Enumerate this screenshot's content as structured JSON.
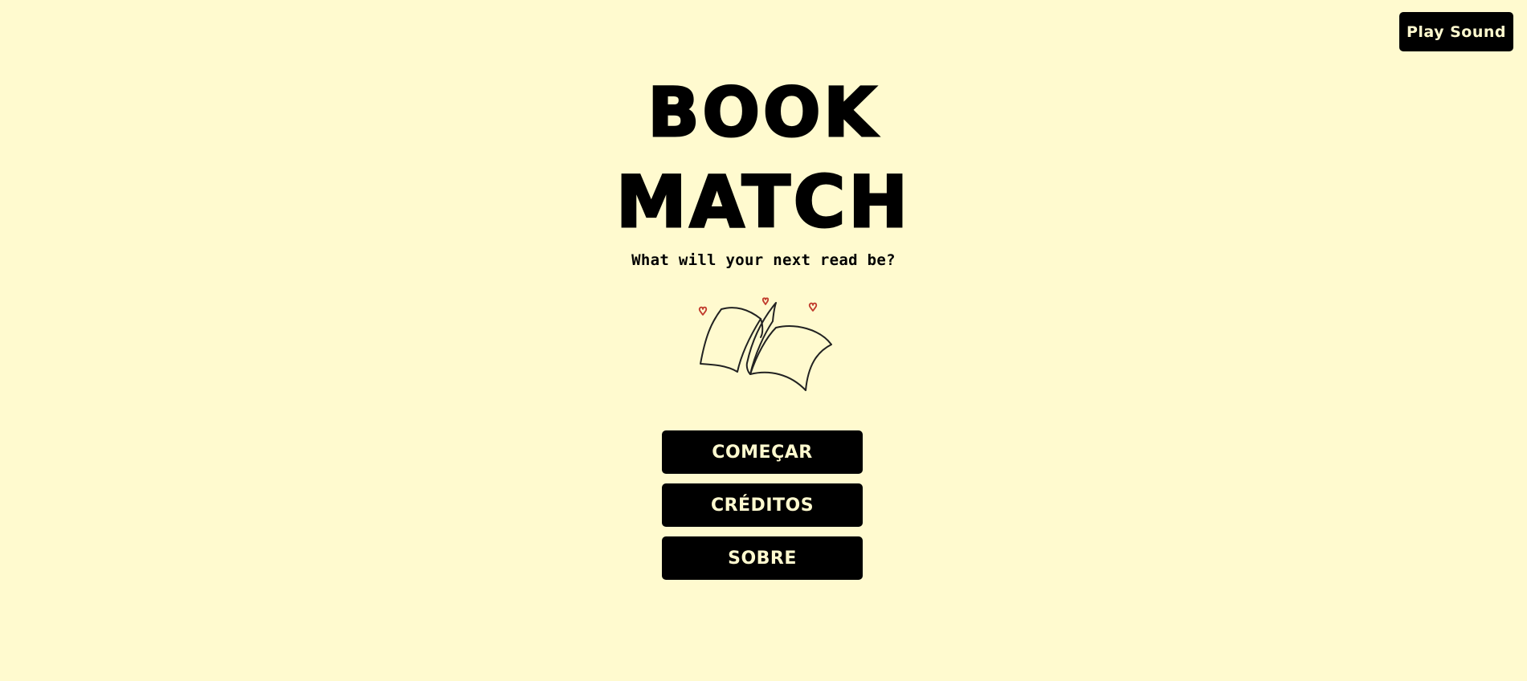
{
  "header": {
    "sound_button_label": "Play Sound"
  },
  "hero": {
    "title_line1": "BOOK",
    "title_line2": "MATCH",
    "tagline": "What will your next read be?",
    "illustration_icon": "open-book-with-hearts-icon"
  },
  "menu": {
    "start_label": "COMEÇAR",
    "credits_label": "CRÉDITOS",
    "about_label": "SOBRE"
  },
  "colors": {
    "background": "#fffacf",
    "button_bg": "#000000",
    "button_text": "#fffacf",
    "heart": "#c0392b"
  }
}
